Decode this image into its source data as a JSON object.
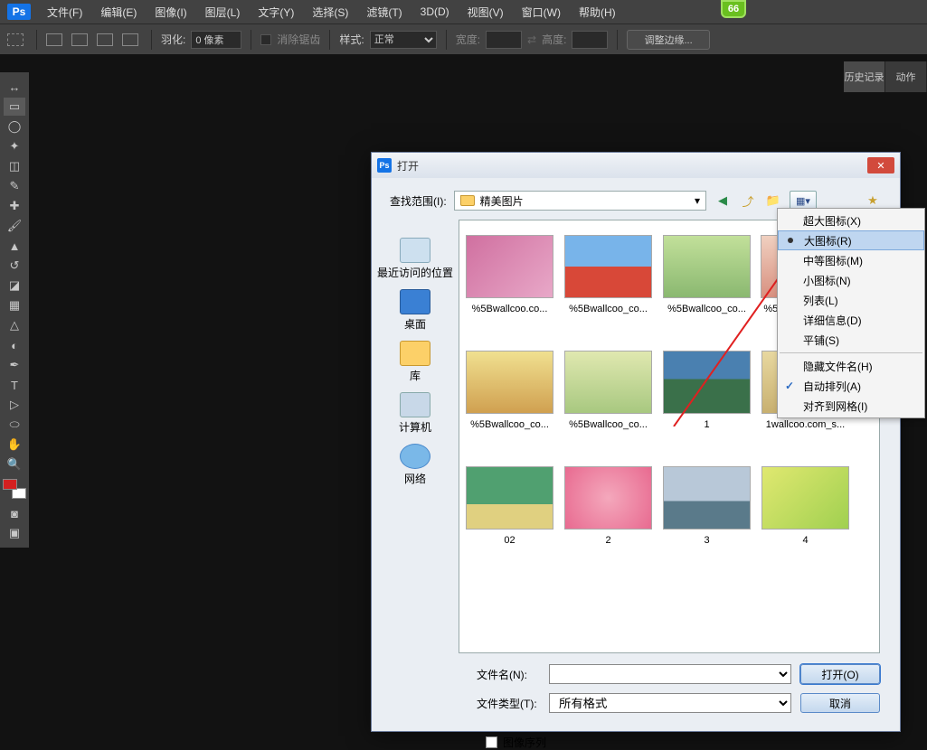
{
  "app": {
    "logo": "Ps",
    "badge": "66"
  },
  "menu": [
    "文件(F)",
    "编辑(E)",
    "图像(I)",
    "图层(L)",
    "文字(Y)",
    "选择(S)",
    "滤镜(T)",
    "3D(D)",
    "视图(V)",
    "窗口(W)",
    "帮助(H)"
  ],
  "options": {
    "feather_label": "羽化:",
    "feather_value": "0 像素",
    "antialias": "消除锯齿",
    "style_label": "样式:",
    "style_value": "正常",
    "width_label": "宽度:",
    "height_label": "高度:",
    "refine": "调整边缘..."
  },
  "right_tabs": [
    "历史记录",
    "动作"
  ],
  "dialog": {
    "title": "打开",
    "lookin_label": "查找范围(I):",
    "lookin_value": "精美图片",
    "places": [
      {
        "label": "最近访问的位置",
        "cls": "pi-recent"
      },
      {
        "label": "桌面",
        "cls": "pi-desktop"
      },
      {
        "label": "库",
        "cls": "pi-lib"
      },
      {
        "label": "计算机",
        "cls": "pi-comp"
      },
      {
        "label": "网络",
        "cls": "pi-net"
      }
    ],
    "files": {
      "row1": [
        "%5Bwallcoo.co...",
        "%5Bwallcoo_co...",
        "%5Bwallcoo_co...",
        "%5E"
      ],
      "row2": [
        "%5Bwallcoo_co...",
        "%5Bwallcoo_co...",
        "1",
        "1wallcoo.com_s..."
      ],
      "row3": [
        "02",
        "2",
        "3",
        "4"
      ]
    },
    "filename_label": "文件名(N):",
    "filetype_label": "文件类型(T):",
    "filetype_value": "所有格式",
    "open_btn": "打开(O)",
    "cancel_btn": "取消",
    "sequence": "图像序列"
  },
  "view_menu": [
    {
      "label": "超大图标(X)"
    },
    {
      "label": "大图标(R)",
      "bullet": true,
      "hl": true
    },
    {
      "label": "中等图标(M)"
    },
    {
      "label": "小图标(N)"
    },
    {
      "label": "列表(L)"
    },
    {
      "label": "详细信息(D)"
    },
    {
      "label": "平铺(S)"
    },
    {
      "sep": true
    },
    {
      "label": "隐藏文件名(H)"
    },
    {
      "label": "自动排列(A)",
      "check": true
    },
    {
      "label": "对齐到网格(I)"
    }
  ]
}
